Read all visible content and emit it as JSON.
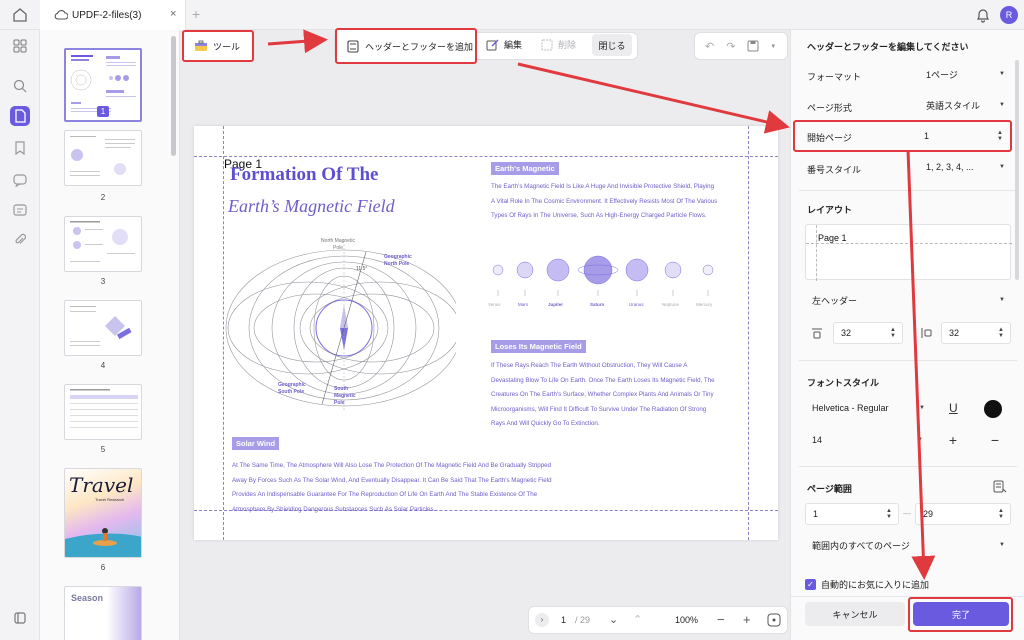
{
  "tab": {
    "title": "UPDF-2-files(3)",
    "avatar": "R"
  },
  "toolbar": {
    "tool_label": "ツール",
    "header_footer_label": "ヘッダーとフッターを追加",
    "edit_label": "編集",
    "delete_label": "削除",
    "close_label": "閉じる"
  },
  "thumbnails": [
    "1",
    "2",
    "3",
    "4",
    "5",
    "6"
  ],
  "page": {
    "header_text": "Page 1",
    "title1": "Formation Of The",
    "title2": "Earth’s Magnetic Field",
    "tag1": "Earth's Magnetic",
    "para1": "The Earth's Magnetic Field Is Like A Huge And Invisible Protective Shield, Playing A Vital Role In The Cosmic Environment. It Effectively Resists Most Of The Various Types Of Rays In The Universe, Such As High-Energy Charged Particle Flows.",
    "labels": {
      "north_mag": "North Magnetic Pole",
      "geo_north": "Geographic North Pole",
      "geo_south": "Geographic South Pole",
      "south_mag": "South Magnetic Pole",
      "angle": "11.5°"
    },
    "planets": [
      "Venus",
      "Mars",
      "Jupiter",
      "Saturn",
      "Uranus",
      "Neptune",
      "Mercury"
    ],
    "tag2": "Loses Its Magnetic Field",
    "para2": "If These Rays Reach The Earth Without Obstruction, They Will Cause A Devastating Blow To Life On Earth. Once The Earth Loses Its Magnetic Field, The Creatures On The Earth's Surface, Whether Complex Plants And Animals Or Tiny Microorganisms, Will Find It Difficult To Survive Under The Radiation Of Strong Rays And Will Quickly Go To Extinction.",
    "tag3": "Solar Wind",
    "para3": "At The Same Time, The Atmosphere Will Also Lose The Protection Of The Magnetic Field And Be Gradually Stripped Away By Forces Such As The Solar Wind, And Eventually Disappear. It Can Be Said That The Earth's Magnetic Field Provides An Indispensable Guarantee For The Reproduction Of Life On Earth And The Stable Existence Of The Atmosphere By Shielding Dangerous Substances Such As Solar Particles."
  },
  "thumb6": {
    "title": "Travel",
    "sub": "Travel Research"
  },
  "thumb7": {
    "title": "Season"
  },
  "bottom": {
    "page": "1",
    "total": "/ 29",
    "zoom": "100%"
  },
  "panel": {
    "title": "ヘッダーとフッターを編集してください",
    "format_label": "フォーマット",
    "format_value": "1ページ",
    "page_style_label": "ページ形式",
    "page_style_value": "英語スタイル",
    "start_page_label": "開始ページ",
    "start_page_value": "1",
    "number_style_label": "番号スタイル",
    "number_style_value": "1, 2, 3, 4, ...",
    "layout_label": "レイアウト",
    "layout_preview": "Page 1",
    "position_value": "左ヘッダー",
    "margin_top": "32",
    "margin_side": "32",
    "font_style_label": "フォントスタイル",
    "font_value": "Helvetica - Regular",
    "underline": "U",
    "font_size": "14",
    "plus": "+",
    "minus": "−",
    "range_label": "ページ範囲",
    "range_from": "1",
    "range_dash": "—",
    "range_to": "29",
    "range_mode": "範囲内のすべてのページ",
    "favorite_label": "自動的にお気に入りに追加",
    "cancel_label": "キャンセル",
    "done_label": "完了"
  }
}
